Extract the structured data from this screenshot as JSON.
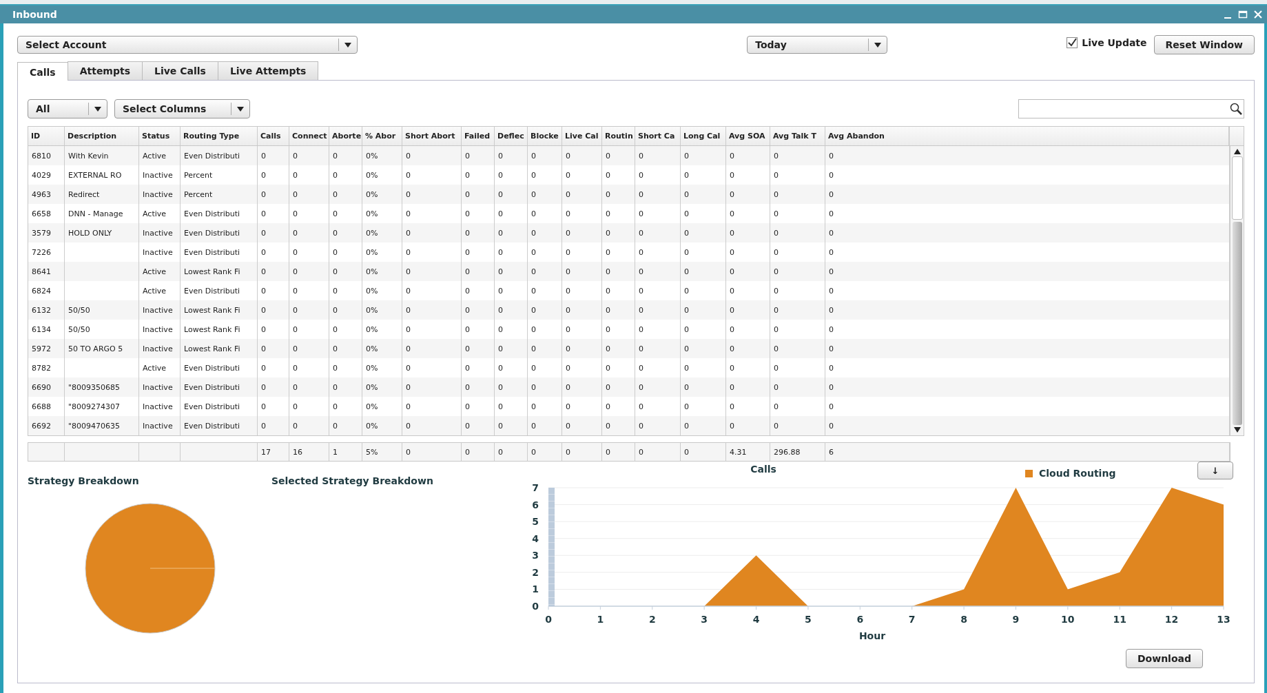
{
  "window": {
    "title": "Inbound"
  },
  "account_select": {
    "value": "Select Account"
  },
  "date_select": {
    "value": "Today"
  },
  "live_update": {
    "label": "Live Update",
    "checked": true
  },
  "reset_button": {
    "label": "Reset Window"
  },
  "tabs": [
    {
      "label": "Calls",
      "selected": true
    },
    {
      "label": "Attempts",
      "selected": false
    },
    {
      "label": "Live Calls",
      "selected": false
    },
    {
      "label": "Live Attempts",
      "selected": false
    }
  ],
  "status_filter": {
    "value": "All"
  },
  "columns_select": {
    "value": "Select Columns"
  },
  "table": {
    "columns": [
      "ID",
      "Description",
      "Status",
      "Routing Type",
      "Calls",
      "Connect",
      "Aborte",
      "% Abor",
      "Short Abort",
      "Failed",
      "Deflec",
      "Blocke",
      "Live Cal",
      "Routin",
      "Short Ca",
      "Long Cal",
      "Avg SOA",
      "Avg Talk T",
      "Avg Abandon"
    ],
    "rows": [
      [
        "6810",
        "With Kevin",
        "Active",
        "Even Distributi",
        "0",
        "0",
        "0",
        "0%",
        "0",
        "0",
        "0",
        "0",
        "0",
        "0",
        "0",
        "0",
        "0",
        "0",
        "0"
      ],
      [
        "4029",
        "EXTERNAL RO",
        "Inactive",
        "Percent",
        "0",
        "0",
        "0",
        "0%",
        "0",
        "0",
        "0",
        "0",
        "0",
        "0",
        "0",
        "0",
        "0",
        "0",
        "0"
      ],
      [
        "4963",
        "Redirect",
        "Inactive",
        "Percent",
        "0",
        "0",
        "0",
        "0%",
        "0",
        "0",
        "0",
        "0",
        "0",
        "0",
        "0",
        "0",
        "0",
        "0",
        "0"
      ],
      [
        "6658",
        "DNN - Manage",
        "Active",
        "Even Distributi",
        "0",
        "0",
        "0",
        "0%",
        "0",
        "0",
        "0",
        "0",
        "0",
        "0",
        "0",
        "0",
        "0",
        "0",
        "0"
      ],
      [
        "3579",
        "HOLD ONLY",
        "Inactive",
        "Even Distributi",
        "0",
        "0",
        "0",
        "0%",
        "0",
        "0",
        "0",
        "0",
        "0",
        "0",
        "0",
        "0",
        "0",
        "0",
        "0"
      ],
      [
        "7226",
        null,
        "Inactive",
        "Even Distributi",
        "0",
        "0",
        "0",
        "0%",
        "0",
        "0",
        "0",
        "0",
        "0",
        "0",
        "0",
        "0",
        "0",
        "0",
        "0"
      ],
      [
        "8641",
        null,
        "Active",
        "Lowest Rank Fi",
        "0",
        "0",
        "0",
        "0%",
        "0",
        "0",
        "0",
        "0",
        "0",
        "0",
        "0",
        "0",
        "0",
        "0",
        "0"
      ],
      [
        "6824",
        null,
        "Active",
        "Even Distributi",
        "0",
        "0",
        "0",
        "0%",
        "0",
        "0",
        "0",
        "0",
        "0",
        "0",
        "0",
        "0",
        "0",
        "0",
        "0"
      ],
      [
        "6132",
        "50/50",
        "Inactive",
        "Lowest Rank Fi",
        "0",
        "0",
        "0",
        "0%",
        "0",
        "0",
        "0",
        "0",
        "0",
        "0",
        "0",
        "0",
        "0",
        "0",
        "0"
      ],
      [
        "6134",
        "50/50",
        "Inactive",
        "Lowest Rank Fi",
        "0",
        "0",
        "0",
        "0%",
        "0",
        "0",
        "0",
        "0",
        "0",
        "0",
        "0",
        "0",
        "0",
        "0",
        "0"
      ],
      [
        "5972",
        "50 TO ARGO 5",
        "Inactive",
        "Lowest Rank Fi",
        "0",
        "0",
        "0",
        "0%",
        "0",
        "0",
        "0",
        "0",
        "0",
        "0",
        "0",
        "0",
        "0",
        "0",
        "0"
      ],
      [
        "8782",
        null,
        "Active",
        "Even Distributi",
        "0",
        "0",
        "0",
        "0%",
        "0",
        "0",
        "0",
        "0",
        "0",
        "0",
        "0",
        "0",
        "0",
        "0",
        "0"
      ],
      [
        "6690",
        "\"8009350685",
        "Inactive",
        "Even Distributi",
        "0",
        "0",
        "0",
        "0%",
        "0",
        "0",
        "0",
        "0",
        "0",
        "0",
        "0",
        "0",
        "0",
        "0",
        "0"
      ],
      [
        "6688",
        "\"8009274307",
        "Inactive",
        "Even Distributi",
        "0",
        "0",
        "0",
        "0%",
        "0",
        "0",
        "0",
        "0",
        "0",
        "0",
        "0",
        "0",
        "0",
        "0",
        "0"
      ],
      [
        "6692",
        "\"8009470635",
        "Inactive",
        "Even Distributi",
        "0",
        "0",
        "0",
        "0%",
        "0",
        "0",
        "0",
        "0",
        "0",
        "0",
        "0",
        "0",
        "0",
        "0",
        "0"
      ]
    ],
    "totals": [
      "17",
      "16",
      "1",
      "5%",
      "0",
      "0",
      "0",
      "0",
      "0",
      "0",
      "0",
      "0",
      "4.31",
      "296.88",
      "6"
    ]
  },
  "strategy_breakdown": {
    "title": "Strategy Breakdown"
  },
  "selected_strategy_breakdown": {
    "title": "Selected Strategy Breakdown"
  },
  "calls_chart": {
    "export_button": "↓",
    "download_button": "Download",
    "chart_data": {
      "type": "area",
      "title": "Calls",
      "xlabel": "Hour",
      "x": [
        0,
        1,
        2,
        3,
        4,
        5,
        6,
        7,
        8,
        9,
        10,
        11,
        12,
        13
      ],
      "xlim": [
        0,
        13
      ],
      "ylim": [
        0,
        7
      ],
      "grid": true,
      "yticks": [
        0,
        1,
        2,
        3,
        4,
        5,
        6,
        7
      ],
      "xticks": [
        0,
        1,
        2,
        3,
        4,
        5,
        6,
        7,
        8,
        9,
        10,
        11,
        12,
        13
      ],
      "series": [
        {
          "name": "Cloud Routing",
          "color": "#e08620",
          "values": [
            0,
            0,
            0,
            0,
            3,
            0,
            0,
            0,
            1,
            7,
            1,
            2,
            7,
            6
          ]
        }
      ]
    }
  }
}
